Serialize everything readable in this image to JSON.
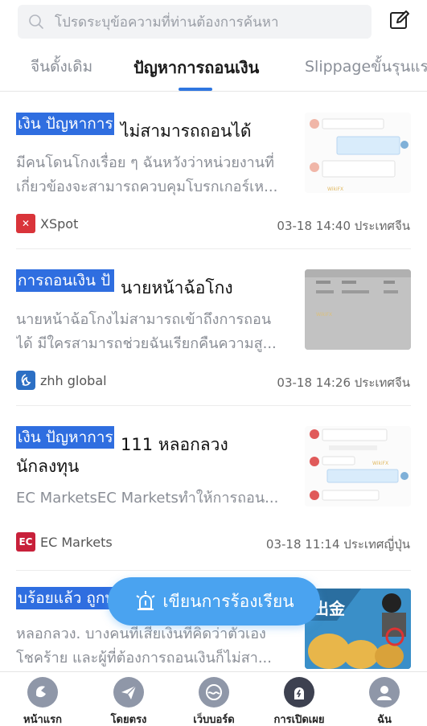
{
  "search": {
    "placeholder": "โปรดระบุข้อความที่ท่านต้องการค้นหา"
  },
  "tabs": [
    {
      "label": "จีนดั้งเดิม"
    },
    {
      "label": "ปัญหาการถอนเงิน",
      "active": true
    },
    {
      "label": "Slippageขั้นรุนแร"
    }
  ],
  "feed": [
    {
      "tag": "เงิน ปัญหาการถ",
      "title": "ไม่สามารถถอนได้",
      "title_line2": "",
      "desc": [
        "มีคนโดนโกงเรื่อย ๆ ฉันหวังว่าหน่วยงานที่",
        "เกี่ยวข้องจะสามารถควบคุมโบรกเกอร์เห..."
      ],
      "broker": "XSpot",
      "logo_color": "#d9343a",
      "meta": "03-18 14:40 ประเทศจีน"
    },
    {
      "tag": "การถอนเงิน ปั",
      "title": "นายหน้าฉ้อโกง",
      "title_line2": "",
      "desc": [
        "นายหน้าฉ้อโกงไม่สามารถเข้าถึงการถอน",
        "ได้ มีใครสามารถช่วยฉันเรียกคืนความสู..."
      ],
      "broker": "zhh global",
      "logo_color": "#2c6fc4",
      "meta": "03-18 14:26 ประเทศจีน"
    },
    {
      "tag": "เงิน ปัญหาการถ",
      "title": "111 หลอกลวง",
      "title_line2": "นักลงทุน",
      "desc": [
        "EC MarketsEC Marketsทำให้การถอน..."
      ],
      "broker": "EC Markets",
      "logo_color": "#c8203a",
      "meta": "03-18 11:14 ประเทศญี่ปุ่น"
    },
    {
      "tag": "บร้อยแล้ว ถูกบ",
      "title": "",
      "title_line2": "",
      "desc": [
        "หลอกลวง. บางคนที่เสียเงินที่คิดว่าตัวเอง",
        "โชคร้าย และผู้ที่ต้องการถอนเงินก็ไม่สา..."
      ],
      "broker": "",
      "logo_color": "",
      "meta": ""
    }
  ],
  "thumb_texts": {
    "watermark": "WikiFX",
    "chat4_banner": "出金"
  },
  "fab": {
    "label": "เขียนการร้องเรียน"
  },
  "bottom_nav": [
    {
      "label": "หน้าแรก",
      "icon": "home-icon"
    },
    {
      "label": "โดยตรง",
      "icon": "send-icon"
    },
    {
      "label": "เว็บบอร์ด",
      "icon": "forum-icon"
    },
    {
      "label": "การเปิดเผย",
      "icon": "exposure-icon",
      "active": true
    },
    {
      "label": "ฉัน",
      "icon": "profile-icon"
    }
  ],
  "colors": {
    "accent": "#2f76e0",
    "tag_bg": "#2f6ee0",
    "fab_bg": "#4aa3f0",
    "nav_icon": "#8f97a8",
    "nav_icon_active": "#3d4150"
  }
}
